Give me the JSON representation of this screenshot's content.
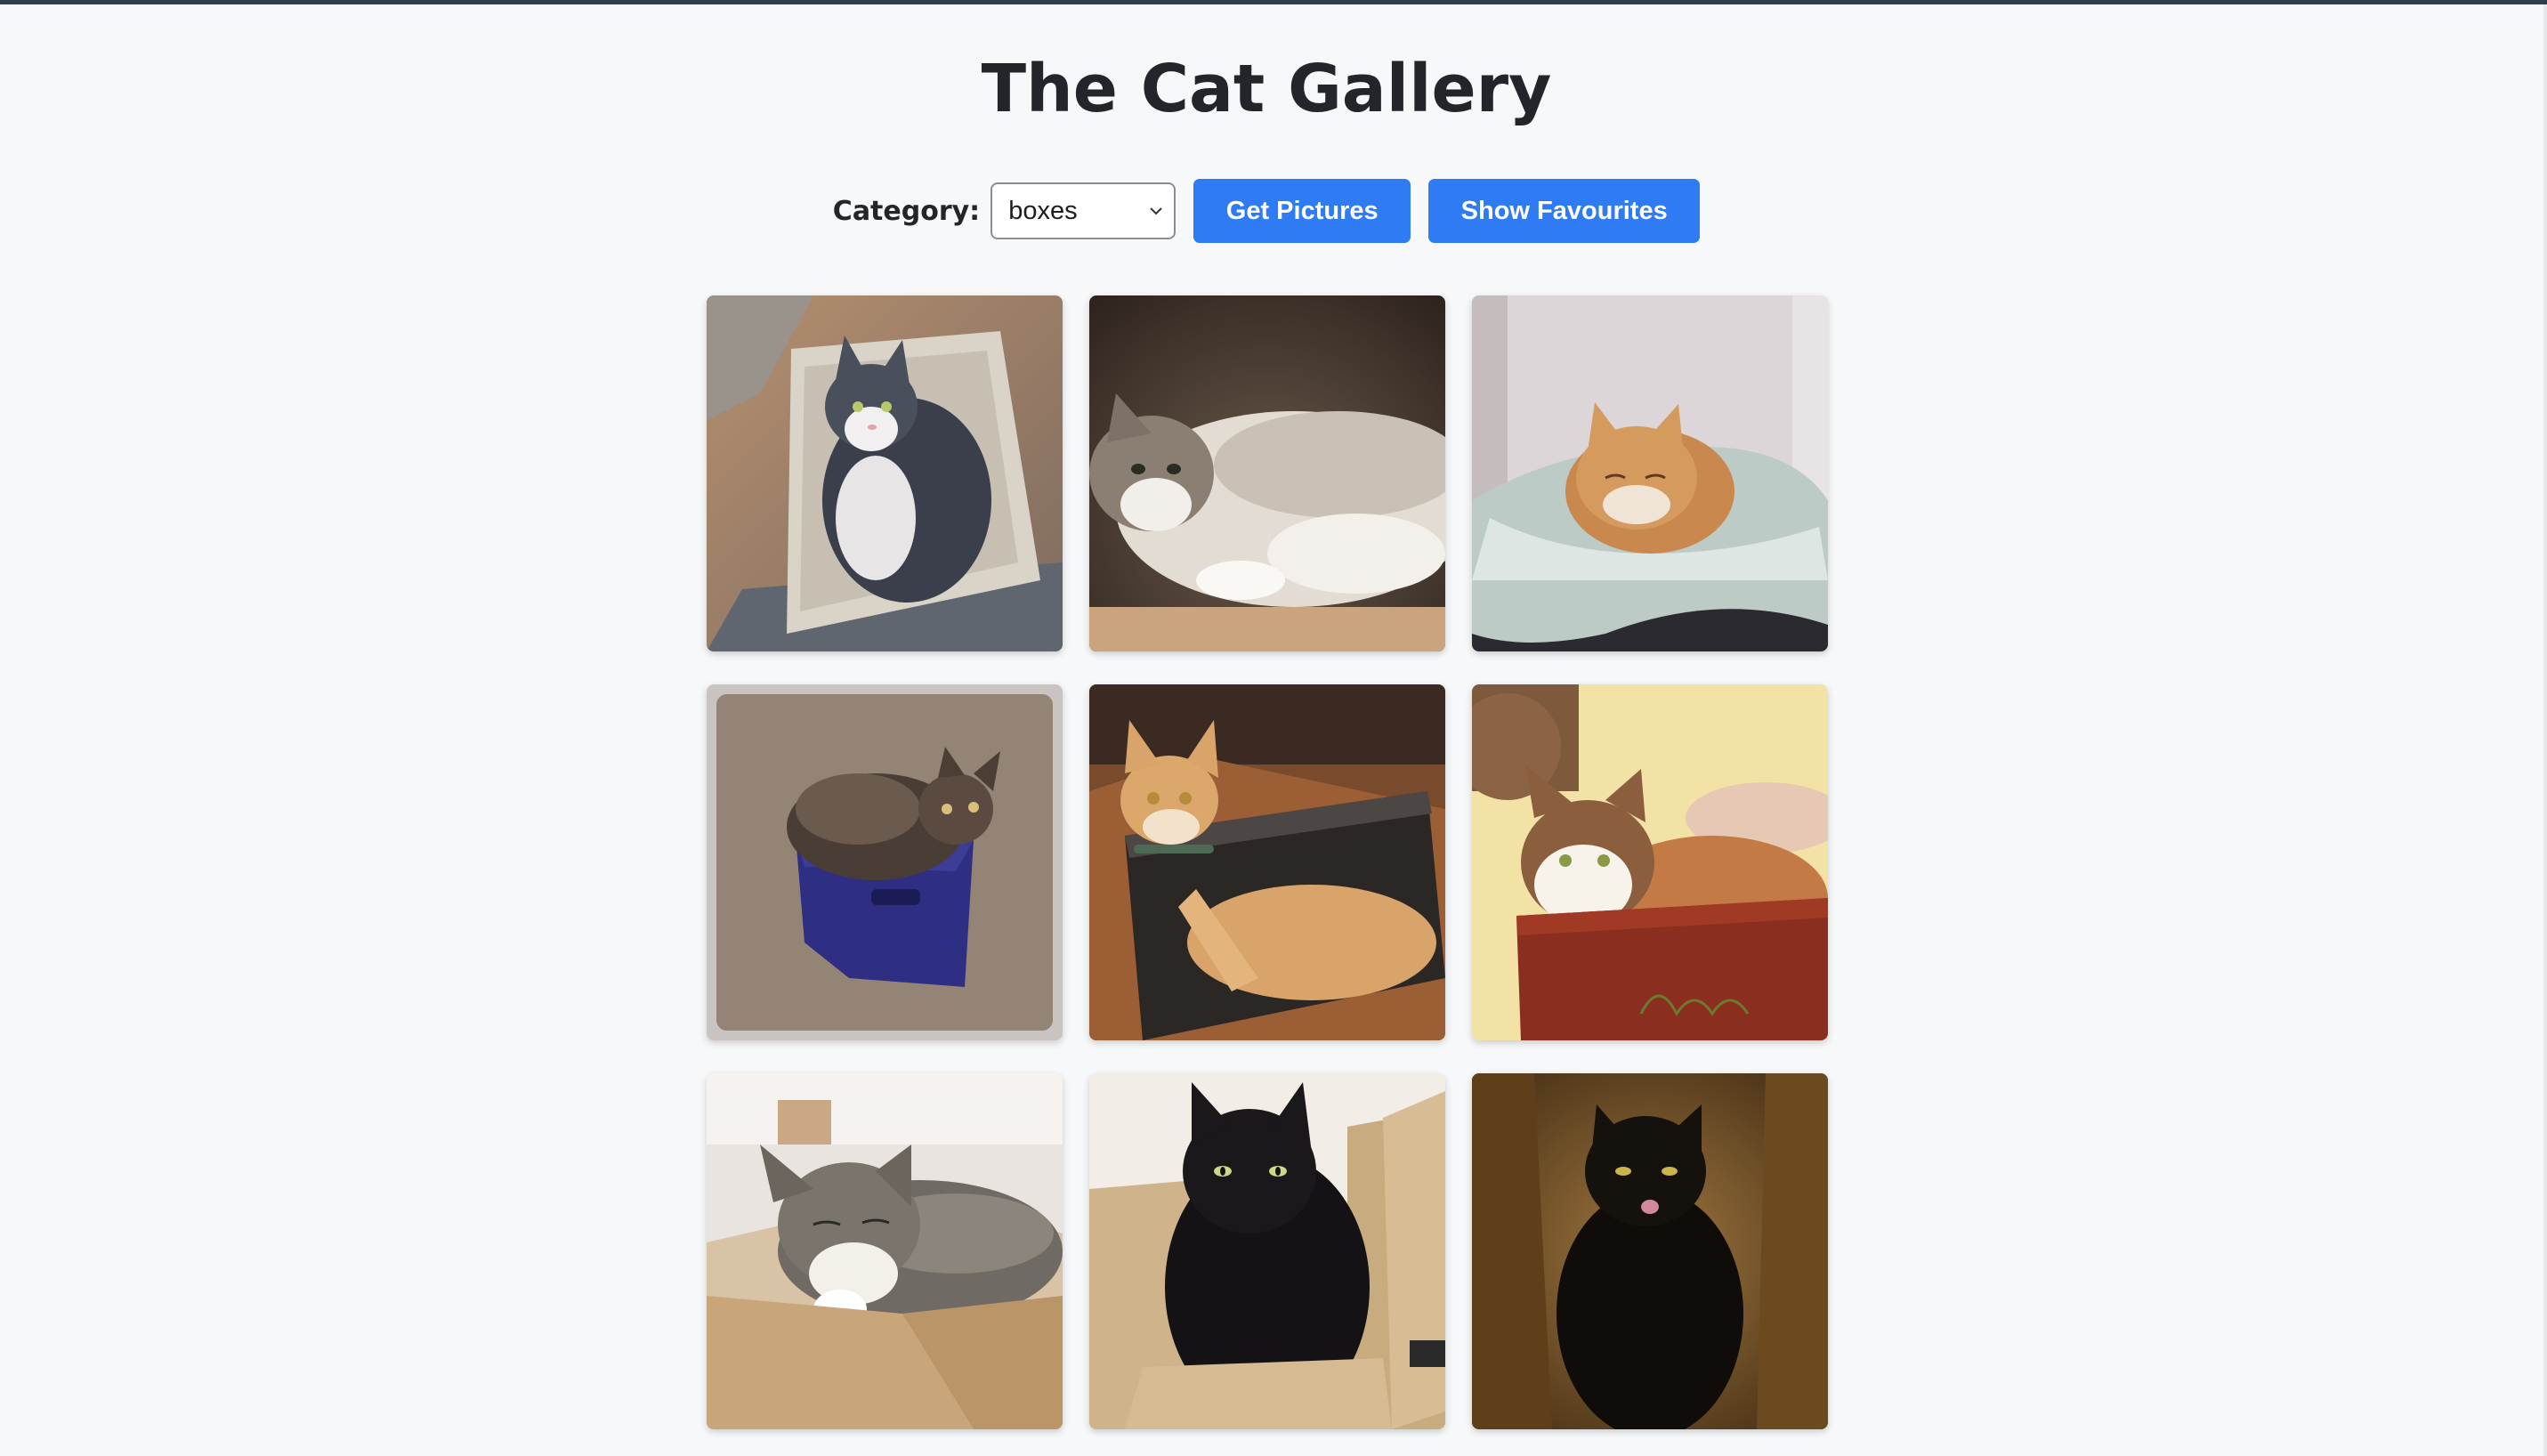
{
  "page": {
    "title": "The Cat Gallery"
  },
  "controls": {
    "category_label": "Category:",
    "category_selected": "boxes",
    "get_pictures_label": "Get Pictures",
    "show_favourites_label": "Show Favourites"
  },
  "colors": {
    "accent": "#2f7bf3",
    "background": "#f6f8f9",
    "title_text": "#22262a",
    "top_border": "#2f3f49"
  },
  "gallery": {
    "photos": [
      {
        "subject": "grey and white cat sitting in a cardboard box on a wooden floor"
      },
      {
        "subject": "fluffy grey tabby cat lying on its side in a box, dark background"
      },
      {
        "subject": "orange tabby cat resting on a towel in a basket"
      },
      {
        "subject": "long-haired tortoiseshell cat in a small blue bin on carpet"
      },
      {
        "subject": "orange tabby cat lying in a dark cardboard box on a wooden floor"
      },
      {
        "subject": "orange and white cat peeking out of a red box"
      },
      {
        "subject": "grey tabby cat with white paws lying in a cardboard box"
      },
      {
        "subject": "black cat sitting in an open cardboard box"
      },
      {
        "subject": "black cat sitting inside a tall cardboard box, licking its nose"
      }
    ]
  }
}
